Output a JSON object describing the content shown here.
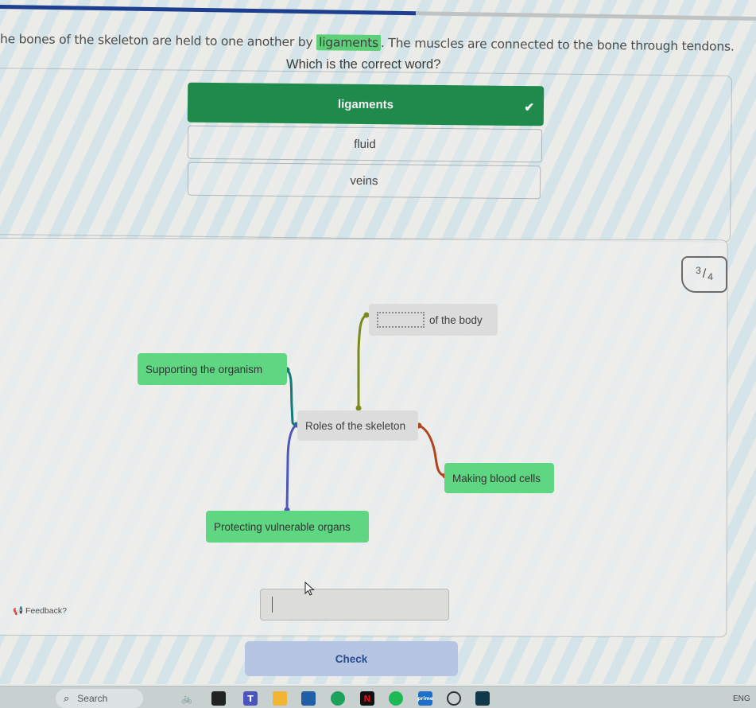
{
  "progress": {
    "fraction": 0.55,
    "fill_color": "#1e3f8f"
  },
  "sentence": {
    "before": "he bones of the skeleton are held to one another by ",
    "highlight": "ligaments",
    "after": ". The muscles are connected to the bone through tendons."
  },
  "question": "Which is the correct word?",
  "options": [
    {
      "label": "ligaments",
      "state": "correct",
      "icon": "check-icon"
    },
    {
      "label": "fluid",
      "state": "unselected"
    },
    {
      "label": "veins",
      "state": "unselected"
    }
  ],
  "counter": {
    "current": "3",
    "separator": "/",
    "total": "4"
  },
  "mindmap": {
    "center": "Roles of the skeleton",
    "nodes": [
      {
        "id": "blank",
        "label": "of the body",
        "has_blank": true,
        "style": "grey"
      },
      {
        "id": "support",
        "label": "Supporting the organism",
        "style": "green"
      },
      {
        "id": "blood",
        "label": "Making blood cells",
        "style": "green"
      },
      {
        "id": "protect",
        "label": "Protecting vulnerable organs",
        "style": "green"
      }
    ],
    "link_colors": {
      "blank": "#7a8a1c",
      "support": "#127a7a",
      "blood": "#b0461f",
      "protect": "#4e57b8"
    }
  },
  "feedback": {
    "icon": "megaphone-icon",
    "label": "Feedback?"
  },
  "answer_input": {
    "value": "",
    "placeholder": ""
  },
  "check_button": "Check",
  "taskbar": {
    "search_label": "Search",
    "apps": [
      "widgets-bike",
      "task-view",
      "teams",
      "file-explorer",
      "microsoft-store",
      "edge",
      "netflix",
      "spotify",
      "prime-video",
      "whatsapp",
      "disney-app"
    ],
    "language": "ENG"
  }
}
